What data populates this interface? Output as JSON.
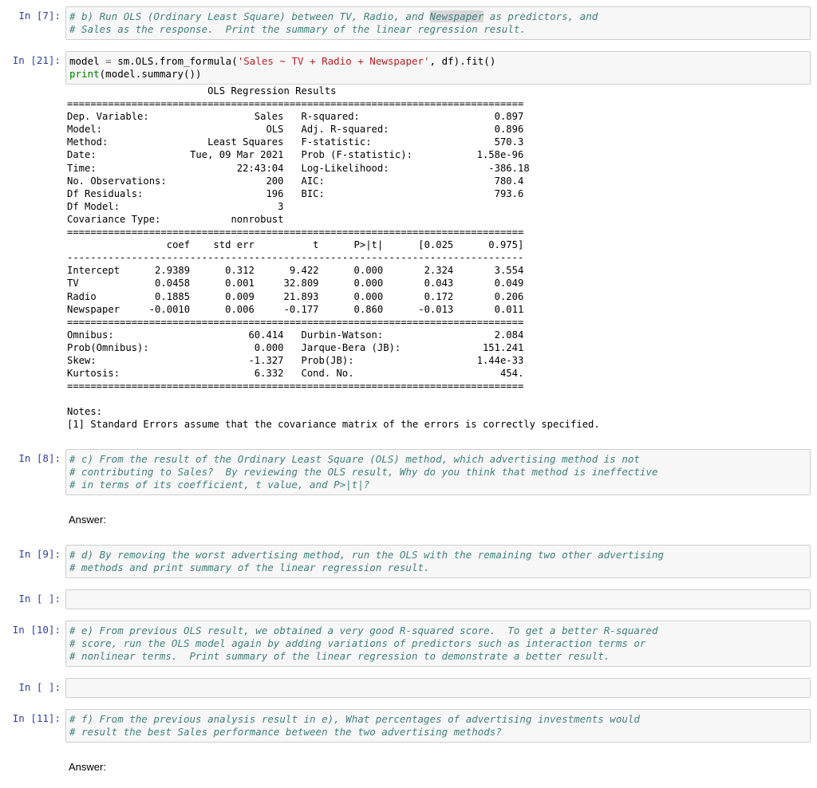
{
  "notebook": {
    "cells": [
      {
        "id": "cell-b-comment",
        "type": "code",
        "prompt": "In [7]:",
        "kind": "comment",
        "lines": [
          "# b) Run OLS (Ordinary Least Square) between TV, Radio, and ",
          "# Sales as the response.  Print the summary of the linear regression result."
        ],
        "highlight_word": "Newspaper",
        "line1_tail": " as predictors, and"
      },
      {
        "id": "cell-ols-model",
        "type": "code",
        "prompt": "In [21]:",
        "kind": "python",
        "code_line1_a": "model ",
        "code_line1_eq": "=",
        "code_line1_b": " sm.OLS.from_formula(",
        "code_line1_str": "'Sales ~ TV + Radio + Newspaper'",
        "code_line1_c": ", df).fit()",
        "code_line2_fn": "print",
        "code_line2_rest": "(model.summary())",
        "output": {
          "title": "                        OLS Regression Results                            ",
          "text": "==============================================================================\nDep. Variable:                  Sales   R-squared:                       0.897\nModel:                            OLS   Adj. R-squared:                  0.896\nMethod:                 Least Squares   F-statistic:                     570.3\nDate:                Tue, 09 Mar 2021   Prob (F-statistic):           1.58e-96\nTime:                        22:43:04   Log-Likelihood:                 -386.18\nNo. Observations:                 200   AIC:                             780.4\nDf Residuals:                     196   BIC:                             793.6\nDf Model:                           3                                         \nCovariance Type:            nonrobust                                         \n==============================================================================\n                 coef    std err          t      P>|t|      [0.025      0.975]\n------------------------------------------------------------------------------\nIntercept      2.9389      0.312      9.422      0.000       2.324       3.554\nTV             0.0458      0.001     32.809      0.000       0.043       0.049\nRadio          0.1885      0.009     21.893      0.000       0.172       0.206\nNewspaper     -0.0010      0.006     -0.177      0.860      -0.013       0.011\n==============================================================================\nOmnibus:                       60.414   Durbin-Watson:                   2.084\nProb(Omnibus):                  0.000   Jarque-Bera (JB):              151.241\nSkew:                          -1.327   Prob(JB):                     1.44e-33\nKurtosis:                       6.332   Cond. No.                         454.\n==============================================================================\n\nNotes:\n[1] Standard Errors assume that the covariance matrix of the errors is correctly specified."
        },
        "regression_results": {
          "title": "OLS Regression Results",
          "header_left": [
            {
              "label": "Dep. Variable:",
              "value": "Sales"
            },
            {
              "label": "Model:",
              "value": "OLS"
            },
            {
              "label": "Method:",
              "value": "Least Squares"
            },
            {
              "label": "Date:",
              "value": "Tue, 09 Mar 2021"
            },
            {
              "label": "Time:",
              "value": "22:43:04"
            },
            {
              "label": "No. Observations:",
              "value": "200"
            },
            {
              "label": "Df Residuals:",
              "value": "196"
            },
            {
              "label": "Df Model:",
              "value": "3"
            },
            {
              "label": "Covariance Type:",
              "value": "nonrobust"
            }
          ],
          "header_right": [
            {
              "label": "R-squared:",
              "value": "0.897"
            },
            {
              "label": "Adj. R-squared:",
              "value": "0.896"
            },
            {
              "label": "F-statistic:",
              "value": "570.3"
            },
            {
              "label": "Prob (F-statistic):",
              "value": "1.58e-96"
            },
            {
              "label": "Log-Likelihood:",
              "value": "-386.18"
            },
            {
              "label": "AIC:",
              "value": "780.4"
            },
            {
              "label": "BIC:",
              "value": "793.6"
            }
          ],
          "coef_columns": [
            "",
            "coef",
            "std err",
            "t",
            "P>|t|",
            "[0.025",
            "0.975]"
          ],
          "coef_rows": [
            [
              "Intercept",
              "2.9389",
              "0.312",
              "9.422",
              "0.000",
              "2.324",
              "3.554"
            ],
            [
              "TV",
              "0.0458",
              "0.001",
              "32.809",
              "0.000",
              "0.043",
              "0.049"
            ],
            [
              "Radio",
              "0.1885",
              "0.009",
              "21.893",
              "0.000",
              "0.172",
              "0.206"
            ],
            [
              "Newspaper",
              "-0.0010",
              "0.006",
              "-0.177",
              "0.860",
              "-0.013",
              "0.011"
            ]
          ],
          "diagnostics_left": [
            {
              "label": "Omnibus:",
              "value": "60.414"
            },
            {
              "label": "Prob(Omnibus):",
              "value": "0.000"
            },
            {
              "label": "Skew:",
              "value": "-1.327"
            },
            {
              "label": "Kurtosis:",
              "value": "6.332"
            }
          ],
          "diagnostics_right": [
            {
              "label": "Durbin-Watson:",
              "value": "2.084"
            },
            {
              "label": "Jarque-Bera (JB):",
              "value": "151.241"
            },
            {
              "label": "Prob(JB):",
              "value": "1.44e-33"
            },
            {
              "label": "Cond. No.",
              "value": "454."
            }
          ],
          "notes_heading": "Notes:",
          "notes": [
            "[1] Standard Errors assume that the covariance matrix of the errors is correctly specified."
          ]
        }
      },
      {
        "id": "cell-c-comment",
        "type": "code",
        "prompt": "In [8]:",
        "kind": "comment",
        "lines": [
          "# c) From the result of the Ordinary Least Square (OLS) method, which advertising method is not",
          "# contributing to Sales?  By reviewing the OLS result, Why do you think that method is ineffective",
          "# in terms of its coefficient, t value, and P>|t|?"
        ]
      },
      {
        "id": "markdown-answer-1",
        "type": "markdown",
        "text": "Answer:"
      },
      {
        "id": "cell-d-comment",
        "type": "code",
        "prompt": "In [9]:",
        "kind": "comment",
        "lines": [
          "# d) By removing the worst advertising method, run the OLS with the remaining two other advertising",
          "# methods and print summary of the linear regression result."
        ]
      },
      {
        "id": "cell-empty-1",
        "type": "code",
        "prompt": "In [ ]:",
        "kind": "empty",
        "lines": []
      },
      {
        "id": "cell-e-comment",
        "type": "code",
        "prompt": "In [10]:",
        "kind": "comment",
        "lines": [
          "# e) From previous OLS result, we obtained a very good R-squared score.  To get a better R-squared",
          "# score, run the OLS model again by adding variations of predictors such as interaction terms or",
          "# nonlinear terms.  Print summary of the linear regression to demonstrate a better result."
        ]
      },
      {
        "id": "cell-empty-2",
        "type": "code",
        "prompt": "In [ ]:",
        "kind": "empty",
        "lines": []
      },
      {
        "id": "cell-f-comment",
        "type": "code",
        "prompt": "In [11]:",
        "kind": "comment",
        "lines": [
          "# f) From the previous analysis result in e), What percentages of advertising investments would",
          "# result the best Sales performance between the two advertising methods?"
        ]
      },
      {
        "id": "markdown-answer-2",
        "type": "markdown",
        "text": "Answer:"
      }
    ]
  },
  "colors": {
    "prompt": "#303F9F",
    "comment": "#408080",
    "string": "#BA2121",
    "builtin": "#008000",
    "operator": "#666666",
    "cell_background": "#f7f7f7",
    "cell_border": "#cfcfcf",
    "highlight": "#d6d6d6"
  }
}
